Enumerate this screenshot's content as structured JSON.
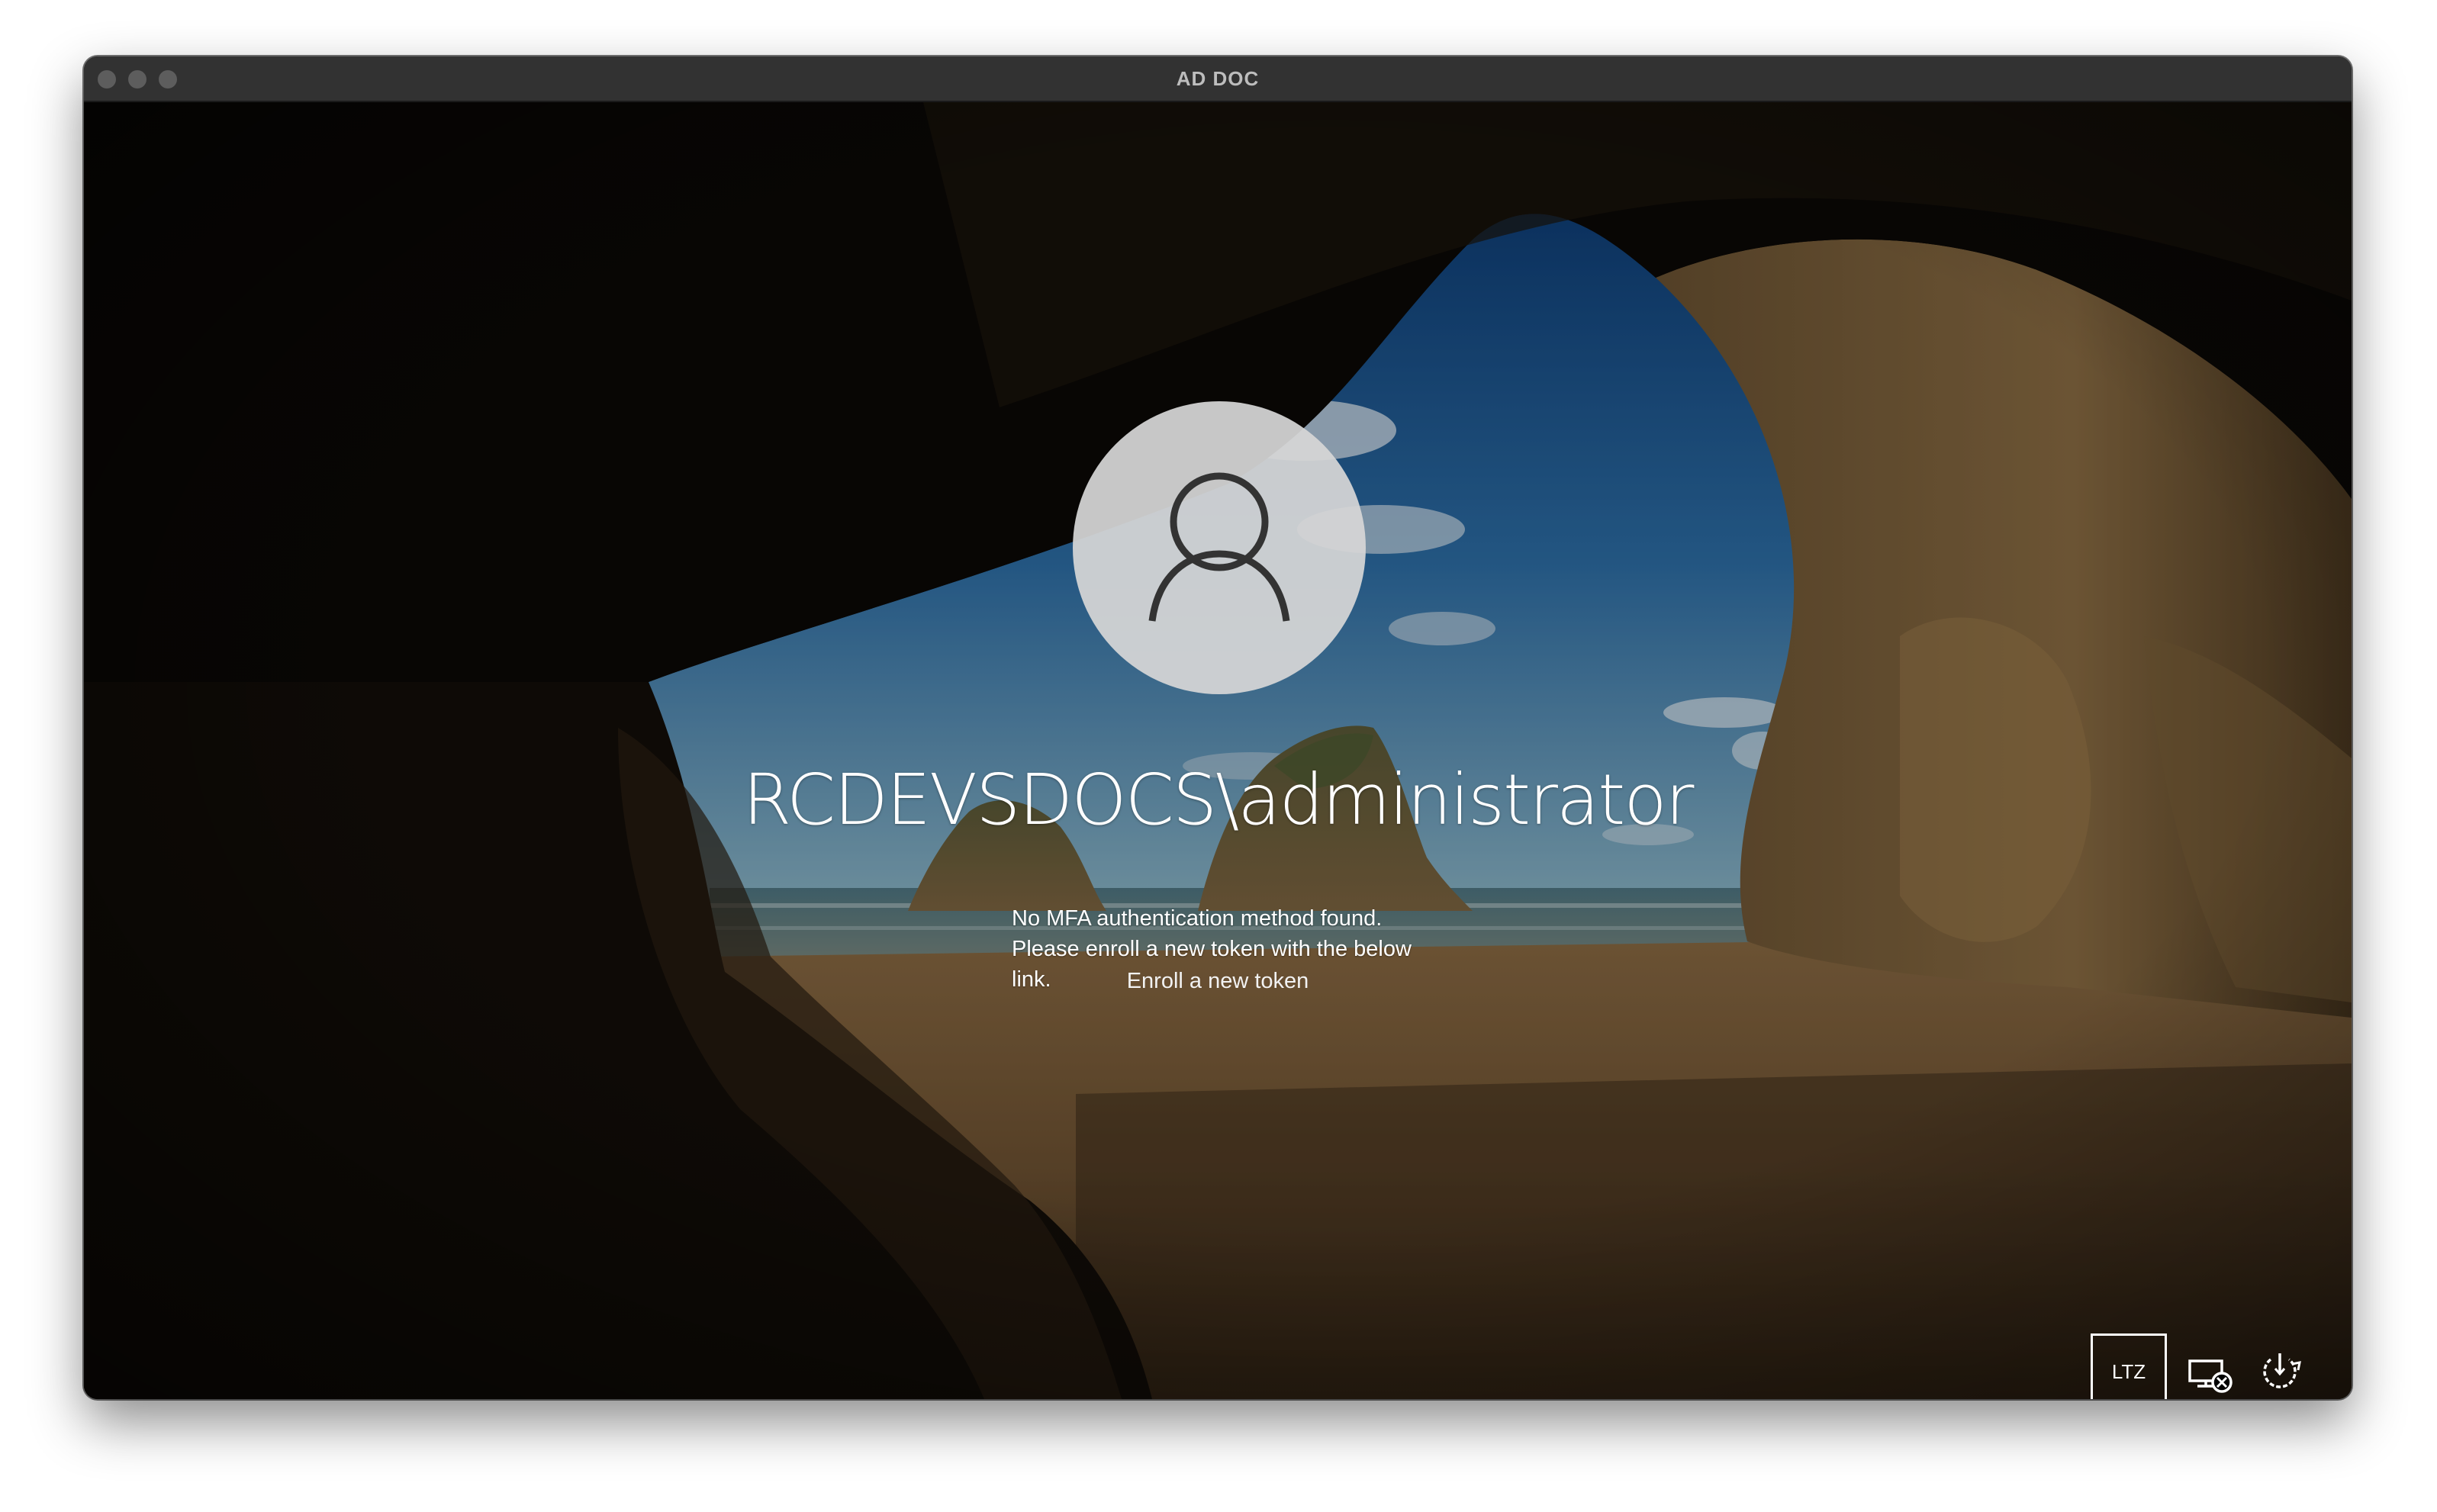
{
  "window": {
    "title": "AD DOC"
  },
  "login": {
    "username": "RCDEVSDOCS\\administrator",
    "message_lines": [
      "No MFA authentication method found.",
      "Please enroll a new token with the below",
      "link."
    ],
    "enroll_link": "Enroll a new token"
  },
  "tray": {
    "language_label": "LTZ",
    "icons": [
      "network-disconnected-icon",
      "power-icon"
    ]
  },
  "colors": {
    "titlebar": "#323232",
    "text": "#ffffff",
    "avatar_bg": "#d6d6d6",
    "avatar_glyph": "#333333"
  }
}
